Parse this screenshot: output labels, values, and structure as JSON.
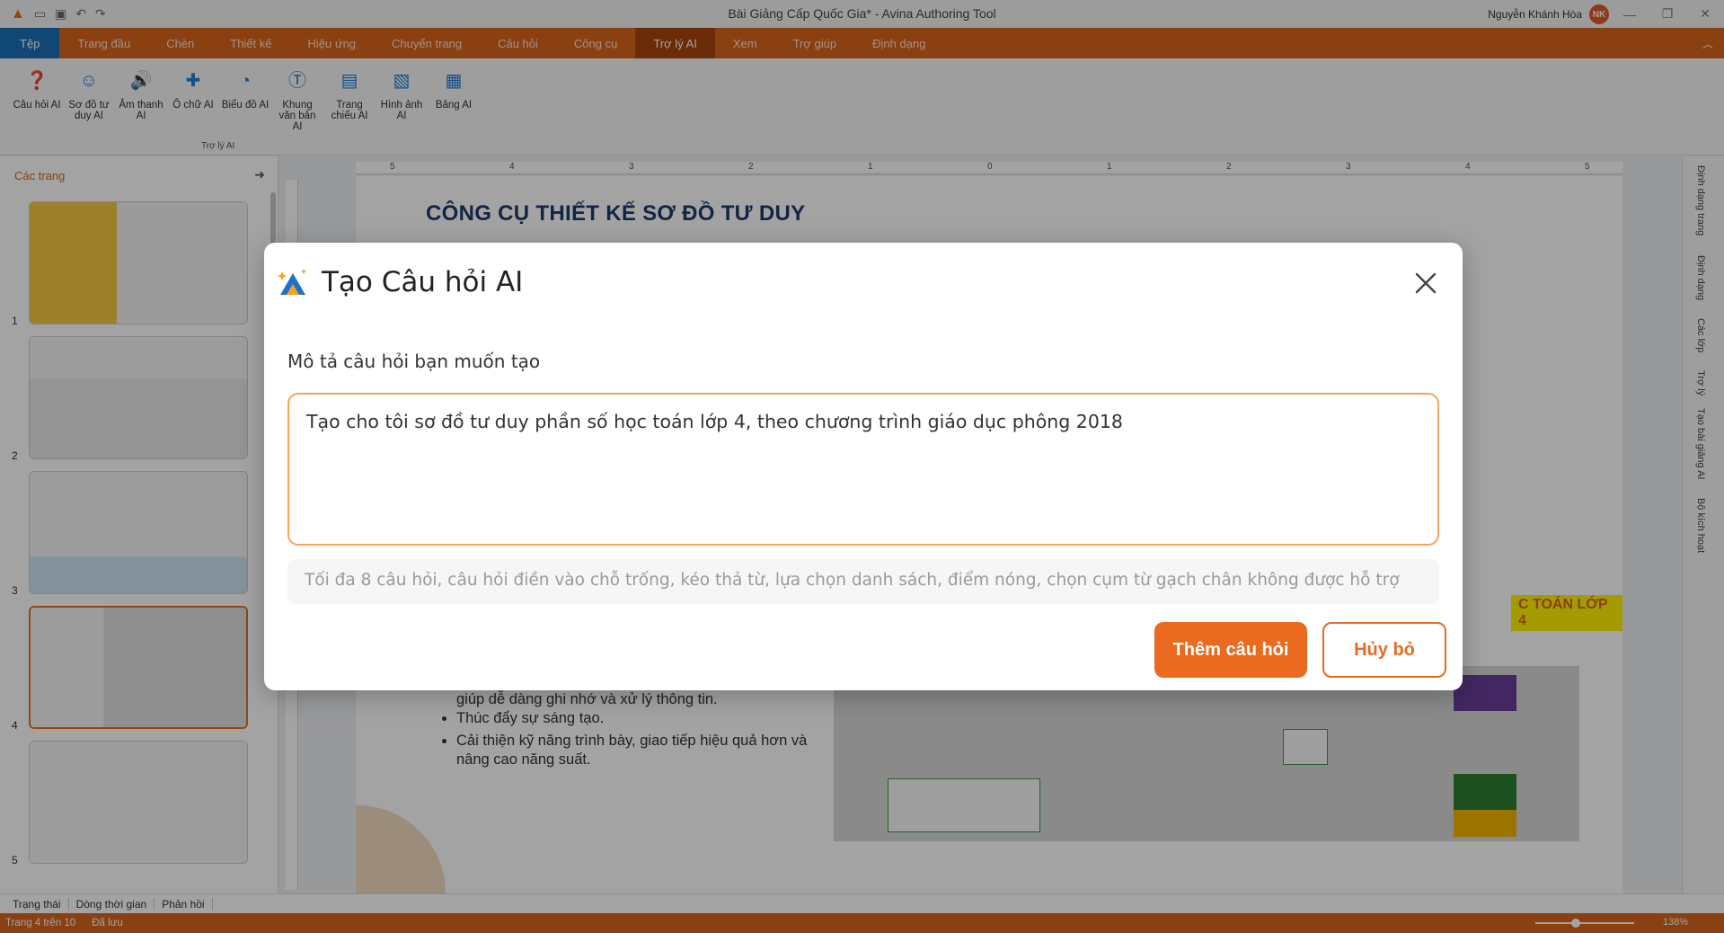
{
  "window": {
    "title": "Bài Giảng Cấp Quốc Gia* - Avina Authoring Tool",
    "user_name": "Nguyễn Khánh Hòa",
    "user_initials": "NK"
  },
  "menu": {
    "tabs": [
      "Tệp",
      "Trang đầu",
      "Chèn",
      "Thiết kế",
      "Hiệu ứng",
      "Chuyển trang",
      "Câu hỏi",
      "Công cụ",
      "Trợ lý AI",
      "Xem",
      "Trợ giúp",
      "Định dạng"
    ],
    "active": "Trợ lý AI"
  },
  "ribbon": {
    "group_label": "Trợ lý AI",
    "buttons": [
      {
        "label": "Câu hỏi AI",
        "icon": "question-ai-icon"
      },
      {
        "label": "Sơ đồ tư duy AI",
        "icon": "mindmap-ai-icon"
      },
      {
        "label": "Âm thanh AI",
        "icon": "audio-ai-icon"
      },
      {
        "label": "Ô chữ AI",
        "icon": "crossword-ai-icon"
      },
      {
        "label": "Biểu đồ AI",
        "icon": "chart-ai-icon"
      },
      {
        "label": "Khung văn bản AI",
        "icon": "textbox-ai-icon"
      },
      {
        "label": "Trang chiếu AI",
        "icon": "slide-ai-icon"
      },
      {
        "label": "Hình ảnh AI",
        "icon": "image-ai-icon"
      },
      {
        "label": "Bảng AI",
        "icon": "table-ai-icon"
      }
    ]
  },
  "slides_panel": {
    "title": "Các trang",
    "numbers": [
      "1",
      "2",
      "3",
      "4",
      "5"
    ],
    "selected": "4"
  },
  "slide": {
    "heading": "CÔNG CỤ THIẾT KẾ SƠ ĐỒ TƯ DUY",
    "bullet_pre": "giúp dễ dàng ghi nhớ và xử lý thông tin.",
    "bullets": [
      "Thúc đẩy sự sáng tạo.",
      "Cải thiện kỹ năng trình bày, giao tiếp hiệu quả hơn và nâng cao năng suất."
    ],
    "mindmap_title": "C TOÁN LỚP 4"
  },
  "ruler": {
    "marks": [
      "5",
      "4",
      "3",
      "2",
      "1",
      "0",
      "1",
      "2",
      "3",
      "4",
      "5"
    ]
  },
  "right_panel": {
    "labels": [
      "Định dạng trang",
      "Định dạng",
      "Các lớp",
      "Trợ lý",
      "Tạo bài giảng AI",
      "Bộ kích hoạt"
    ]
  },
  "bottom_tabs": [
    "Trạng thái",
    "Dòng thời gian",
    "Phản hồi"
  ],
  "status": {
    "page": "Trang 4 trên 10",
    "saved": "Đã lưu",
    "zoom": "138%"
  },
  "modal": {
    "title": "Tạo Câu hỏi AI",
    "field_label": "Mô tả câu hỏi bạn muốn tạo",
    "prompt_value": "Tạo cho tôi sơ đồ tư duy phần số học toán lớp 4, theo chương trình giáo dục phông 2018",
    "hint": "Tối đa 8 câu hỏi, câu hỏi điền vào chỗ trống, kéo thả từ, lựa chọn danh sách, điểm nóng, chọn cụm từ gạch chân không được hỗ trợ",
    "primary_button": "Thêm câu hỏi",
    "secondary_button": "Hủy bỏ"
  },
  "colors": {
    "brand_orange": "#d9641c",
    "button_orange": "#ea6a1f",
    "file_tab_blue": "#1c6fb6",
    "prompt_border": "#f3a65b"
  }
}
